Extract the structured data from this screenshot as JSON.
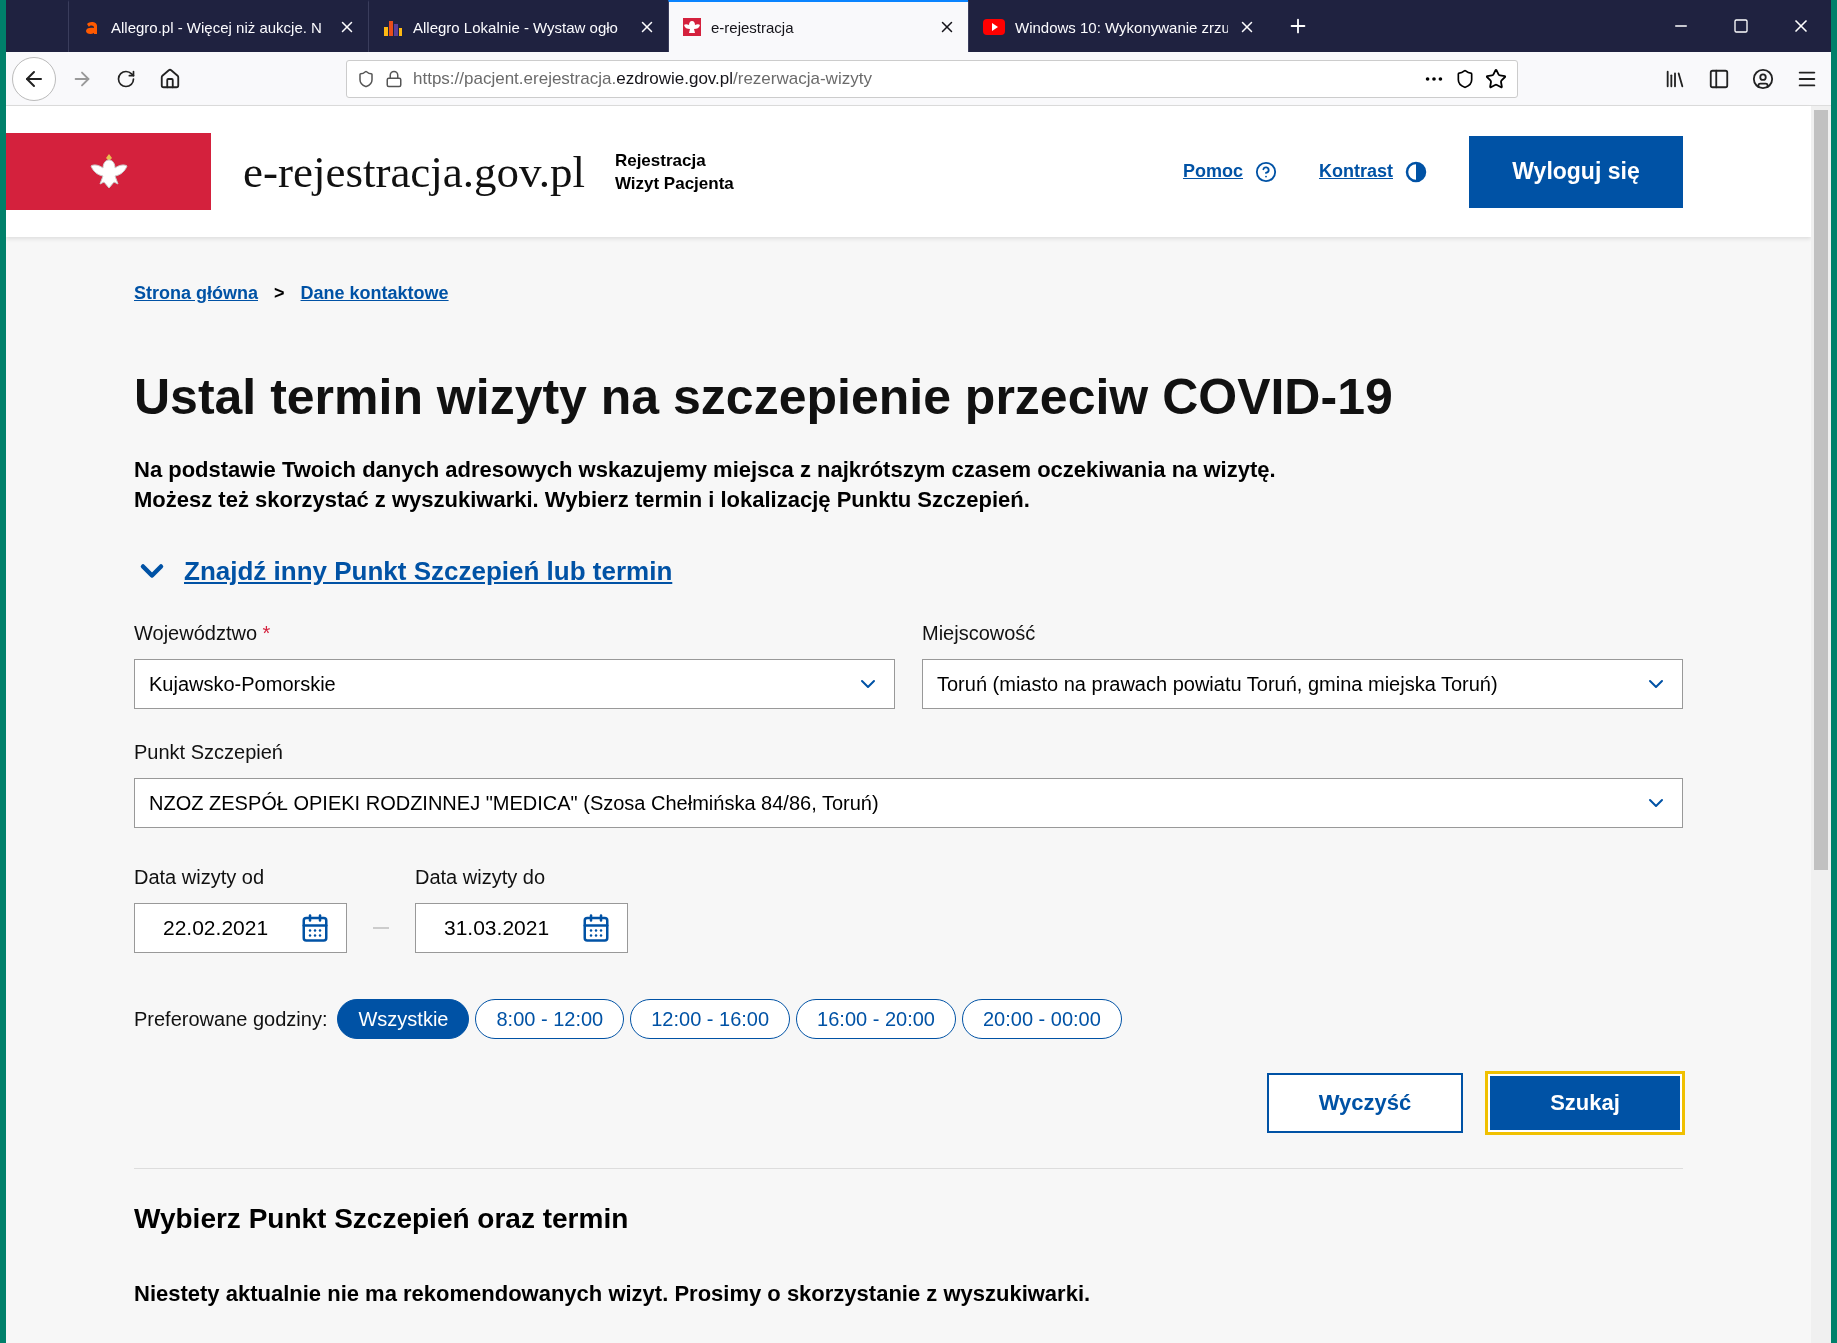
{
  "browser": {
    "tabs": [
      {
        "title": "Allegro.pl - Więcej niż aukcje. N",
        "kind": "letter",
        "selected": false
      },
      {
        "title": "Allegro Lokalnie - Wystaw ogło",
        "kind": "bars",
        "selected": false
      },
      {
        "title": "e-rejestracja",
        "kind": "eagle",
        "selected": true
      },
      {
        "title": "Windows 10: Wykonywanie zrzu",
        "kind": "play",
        "selected": false
      }
    ],
    "url": {
      "host_prefix": "https://pacjent.erejestracja.",
      "domain": "ezdrowie.gov.pl",
      "path": "/rezerwacja-wizyty"
    }
  },
  "header": {
    "logo": "e-rejestracja.gov.pl",
    "subtitle_lines": [
      "Rejestracja",
      "Wizyt Pacjenta"
    ],
    "help": "Pomoc",
    "contrast": "Kontrast",
    "logout": "Wyloguj się"
  },
  "breadcrumbs": {
    "items": [
      "Strona główna",
      "Dane kontaktowe"
    ],
    "separator": ">"
  },
  "title": "Ustal termin wizyty na szczepienie przeciw COVID-19",
  "intro_lines": [
    "Na podstawie Twoich danych adresowych wskazujemy miejsca z najkrótszym czasem oczekiwania na wizytę.",
    "Możesz też skorzystać z wyszukiwarki. Wybierz termin i lokalizację Punktu Szczepień."
  ],
  "search_toggle": {
    "label": "Znajdź inny Punkt Szczepień lub termin",
    "expanded": true
  },
  "form": {
    "province": {
      "label": "Województwo",
      "required_mark": "*",
      "value": "Kujawsko-Pomorskie"
    },
    "town": {
      "label": "Miejscowość",
      "value": "Toruń (miasto na prawach powiatu Toruń, gmina miejska Toruń)"
    },
    "point": {
      "label": "Punkt Szczepień",
      "value": "NZOZ ZESPÓŁ OPIEKI RODZINNEJ \"MEDICA\" (Szosa Chełmińska 84/86, Toruń)"
    },
    "date_from": {
      "label": "Data wizyty od",
      "value": "22.02.2021"
    },
    "date_to": {
      "label": "Data wizyty do",
      "value": "31.03.2021"
    },
    "hours_label": "Preferowane godziny:",
    "hours": [
      {
        "label": "Wszystkie",
        "selected": true
      },
      {
        "label": "8:00 - 12:00",
        "selected": false
      },
      {
        "label": "12:00 - 16:00",
        "selected": false
      },
      {
        "label": "16:00 - 20:00",
        "selected": false
      },
      {
        "label": "20:00 - 00:00",
        "selected": false
      }
    ],
    "clear": "Wyczyść",
    "search": {
      "label": "Szukaj",
      "focused": true
    }
  },
  "results": {
    "heading": "Wybierz Punkt Szczepień oraz termin",
    "message": "Niestety aktualnie nie ma rekomendowanych wizyt. Prosimy o skorzystanie z wyszukiwarki."
  }
}
